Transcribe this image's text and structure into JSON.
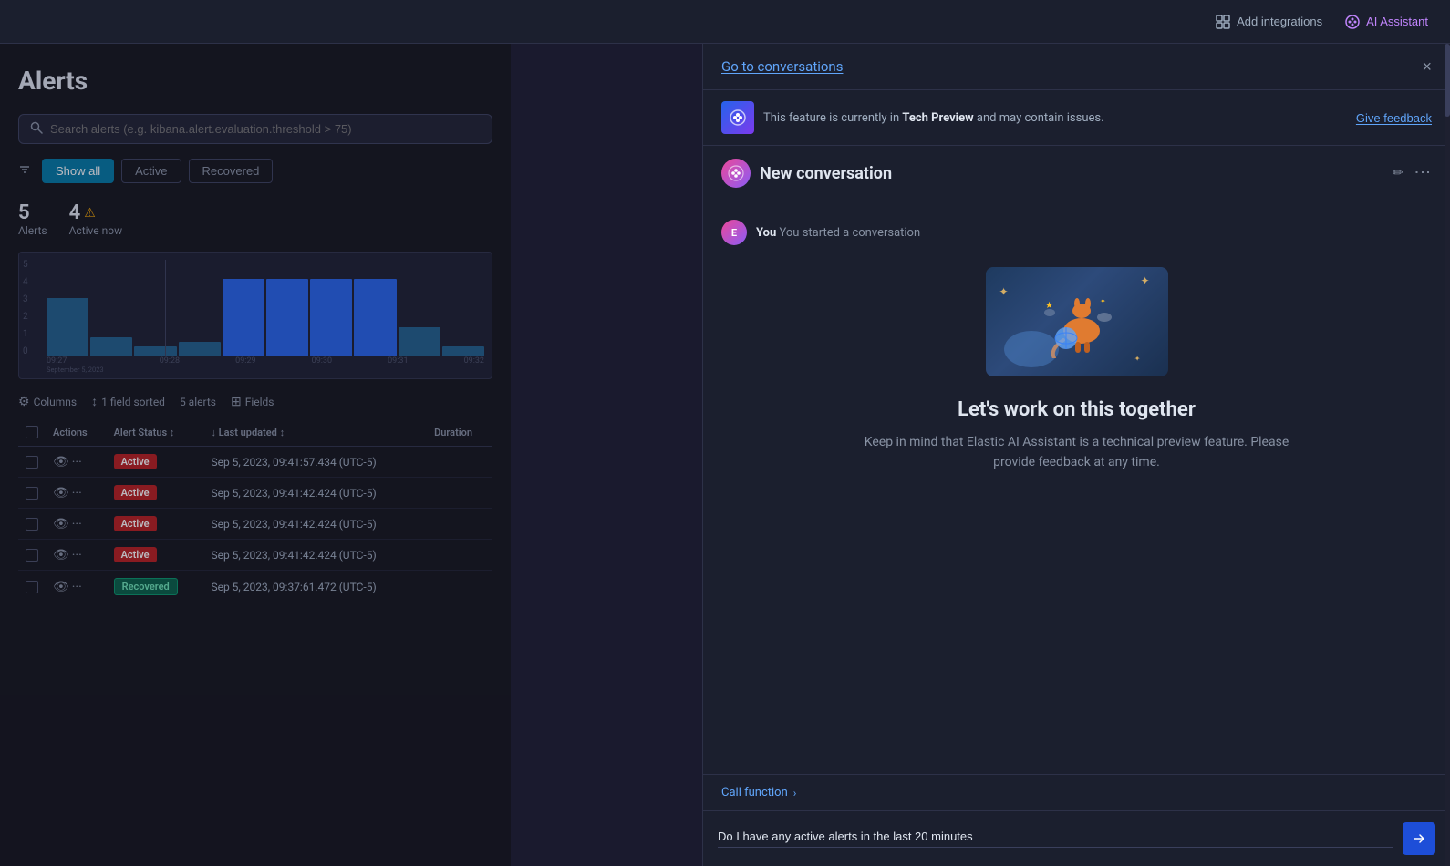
{
  "topbar": {
    "add_integrations_label": "Add integrations",
    "ai_assistant_label": "AI Assistant"
  },
  "alerts_page": {
    "title": "Alerts",
    "search_placeholder": "Search alerts (e.g. kibana.alert.evaluation.threshold > 75)",
    "tabs": [
      {
        "id": "show-all",
        "label": "Show all",
        "active": false
      },
      {
        "id": "active",
        "label": "Active",
        "active": true
      },
      {
        "id": "recovered",
        "label": "Recovered",
        "active": false
      }
    ],
    "stats": {
      "total_count": "5",
      "total_label": "Alerts",
      "active_count": "4",
      "active_label": "Active now"
    },
    "chart": {
      "y_labels": [
        "5",
        "4",
        "3",
        "2",
        "1",
        "0"
      ],
      "x_labels": [
        "09:27\nSeptember 5, 2023",
        "09:28",
        "09:29",
        "09:30",
        "09:31",
        "09:32"
      ]
    },
    "table_controls": {
      "columns_label": "Columns",
      "sort_label": "1 field sorted",
      "alerts_count_label": "5 alerts",
      "fields_label": "Fields"
    },
    "table": {
      "headers": [
        "Actions",
        "Alert Status",
        "Last updated",
        "Duration"
      ],
      "rows": [
        {
          "status": "Active",
          "status_type": "active",
          "last_updated": "Sep 5, 2023, 09:41:57.434 (UTC-5)"
        },
        {
          "status": "Active",
          "status_type": "active",
          "last_updated": "Sep 5, 2023, 09:41:42.424 (UTC-5)"
        },
        {
          "status": "Active",
          "status_type": "active",
          "last_updated": "Sep 5, 2023, 09:41:42.424 (UTC-5)"
        },
        {
          "status": "Active",
          "status_type": "active",
          "last_updated": "Sep 5, 2023, 09:41:42.424 (UTC-5)"
        },
        {
          "status": "Recovered",
          "status_type": "recovered",
          "last_updated": "Sep 5, 2023, 09:37:61.472 (UTC-5)"
        }
      ]
    }
  },
  "ai_panel": {
    "header_link": "Go to conversations",
    "close_label": "×",
    "banner": {
      "text_prefix": "This feature is currently in ",
      "highlight": "Tech Preview",
      "text_suffix": " and may contain issues.",
      "feedback_label": "Give feedback"
    },
    "conversation": {
      "title": "New conversation",
      "pencil": "🖊",
      "avatar_letter": "E",
      "started_text": "You started a conversation"
    },
    "welcome": {
      "title": "Let's work on this together",
      "subtitle": "Keep in mind that Elastic AI Assistant is a technical preview feature. Please provide feedback at any time."
    },
    "footer": {
      "call_function_label": "Call function",
      "chat_placeholder": "Do I have any active alerts in the last 20 minutes",
      "chat_value": "Do I have any active alerts in the last 20 minutes"
    }
  }
}
